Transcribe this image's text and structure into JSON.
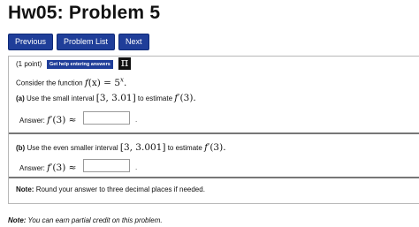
{
  "header": {
    "title": "Hw05: Problem 5"
  },
  "nav": {
    "previous": "Previous",
    "problem_list": "Problem List",
    "next": "Next"
  },
  "problem": {
    "points": "(1 point)",
    "help_button": "Get help entering answers",
    "pi_icon": "π",
    "consider": "Consider the function",
    "function_lhs": "f",
    "function_mid": "(x) = 5",
    "function_exp": "x",
    "function_end": ".",
    "part_a": {
      "label": "(a)",
      "text_before": "Use the small interval",
      "interval": "[3, 3.01]",
      "text_after": "to estimate",
      "target_f": "f",
      "target_rest": "′(3).",
      "answer_label": "Answer:",
      "answer_math_f": "f",
      "answer_math_rest": "′(3) ≈",
      "answer_value": "",
      "trailing": "."
    },
    "part_b": {
      "label": "(b)",
      "text_before": "Use the even smaller interval",
      "interval": "[3, 3.001]",
      "text_after": "to estimate",
      "target_f": "f",
      "target_rest": "′(3).",
      "answer_label": "Answer:",
      "answer_math_f": "f",
      "answer_math_rest": "′(3) ≈",
      "answer_value": "",
      "trailing": "."
    },
    "note_label": "Note:",
    "note_text": "Round your answer to three decimal places if needed."
  },
  "footer": {
    "note_label": "Note:",
    "note_text": "You can earn partial credit on this problem."
  }
}
